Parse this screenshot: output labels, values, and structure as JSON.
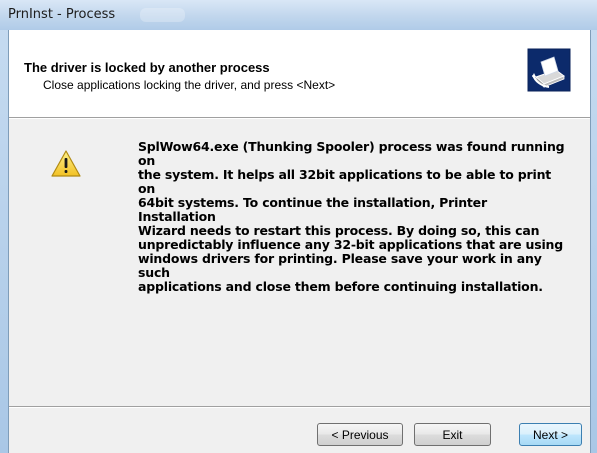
{
  "window": {
    "title": "PrnInst - Process"
  },
  "header": {
    "title": "The driver is locked by another process",
    "subtitle": "Close applications locking the driver, and press <Next>",
    "icon": "printer-install-icon"
  },
  "body": {
    "icon": "warning-icon",
    "message_lines": [
      "SplWow64.exe (Thunking Spooler) process was found running on",
      "the system. It helps all 32bit applications to be able to print on",
      "64bit systems. To continue the installation, Printer Installation",
      "Wizard needs to restart this process. By doing so, this can",
      "unpredictably influence any 32-bit applications that are using",
      "windows drivers for printing. Please save your work in any such",
      "applications and close them before continuing installation."
    ]
  },
  "buttons": {
    "previous": "< Previous",
    "exit": "Exit",
    "next": "Next >"
  },
  "colors": {
    "title_bar": "#bfd5ec",
    "client_bg": "#f0f0f0",
    "header_bg": "#ffffff",
    "warning_yellow": "#f6d33c"
  }
}
